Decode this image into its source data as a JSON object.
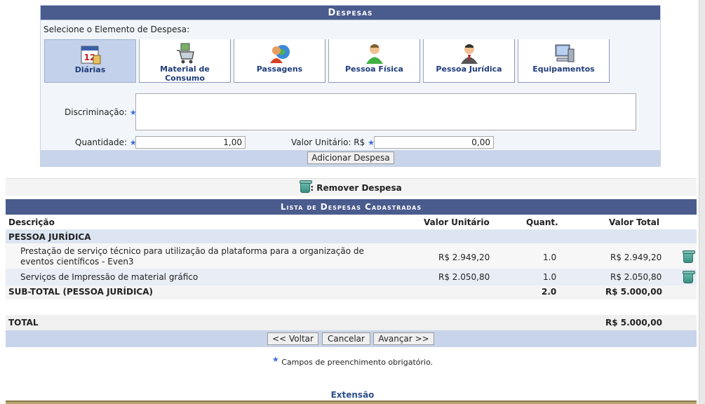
{
  "despesas": {
    "title": "Despesas",
    "select_label": "Selecione o Elemento de Despesa:",
    "elements": [
      {
        "label": "Diárias",
        "icon": "calendar-icon",
        "selected": true
      },
      {
        "label": "Material de Consumo",
        "icon": "shopping-cart-icon",
        "selected": false
      },
      {
        "label": "Passagens",
        "icon": "globe-person-icon",
        "selected": false
      },
      {
        "label": "Pessoa Física",
        "icon": "person-icon",
        "selected": false
      },
      {
        "label": "Pessoa Jurídica",
        "icon": "businessman-icon",
        "selected": false
      },
      {
        "label": "Equipamentos",
        "icon": "computer-icon",
        "selected": false
      }
    ],
    "discriminacao_label": "Discriminação:",
    "discriminacao_value": "",
    "quantidade_label": "Quantidade:",
    "quantidade_value": "1,00",
    "valor_unitario_label": "Valor Unitário: R$",
    "valor_unitario_value": "0,00",
    "add_button": "Adicionar Despesa",
    "required_mark": "★"
  },
  "remover": {
    "label": ": Remover Despesa"
  },
  "lista": {
    "title": "Lista de Despesas Cadastradas",
    "headers": {
      "descricao": "Descrição",
      "valor_unitario": "Valor Unitário",
      "quant": "Quant.",
      "valor_total": "Valor Total"
    },
    "group": "PESSOA JURÍDICA",
    "items": [
      {
        "descricao_1": "Prestação de serviço técnico para utilização da plataforma para a organização de",
        "descricao_2": "eventos científicos - Even3",
        "valor_unitario": "R$ 2.949,20",
        "quant": "1.0",
        "valor_total": "R$ 2.949,20"
      },
      {
        "descricao_1": "Serviços de Impressão de material gráfico",
        "valor_unitario": "R$ 2.050,80",
        "quant": "1.0",
        "valor_total": "R$ 2.050,80"
      }
    ],
    "subtotal": {
      "label": "SUB-TOTAL (PESSOA JURÍDICA)",
      "quant": "2.0",
      "valor": "R$ 5.000,00"
    },
    "total": {
      "label": "TOTAL",
      "valor": "R$ 5.000,00"
    }
  },
  "nav": {
    "voltar": "<< Voltar",
    "cancelar": "Cancelar",
    "avancar": "Avançar >>"
  },
  "footer_note": "Campos de preenchimento obrigatório.",
  "footer_link": "Extensão",
  "colors": {
    "header": "#4a5b8d",
    "selected": "#c3d1ea",
    "accent": "#3a6fd8"
  }
}
